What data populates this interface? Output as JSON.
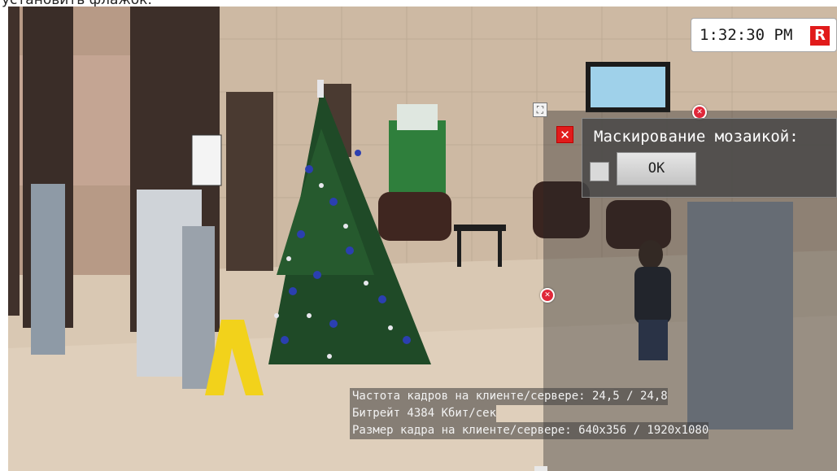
{
  "instruction": {
    "text": "установить флажок."
  },
  "overlay": {
    "clock": {
      "time": "1:32:30 PM",
      "rec_label": "R"
    },
    "mask_panel": {
      "label": "Маскирование мозаикой:",
      "ok_label": "OK",
      "checkbox_checked": false,
      "close_glyph": "✕",
      "move_glyph": "⛶"
    },
    "stats": {
      "fps": "Частота кадров на клиенте/сервере: 24,5 / 24,8",
      "bitrate": "Битрейт 4384 Кбит/сек",
      "frame_size": "Размер кадра на клиенте/сервере: 640x356 / 1920x1080"
    }
  },
  "colors": {
    "close_red": "#e11b1b",
    "rec_red": "#e11b1b",
    "panel_bg": "#464646"
  }
}
